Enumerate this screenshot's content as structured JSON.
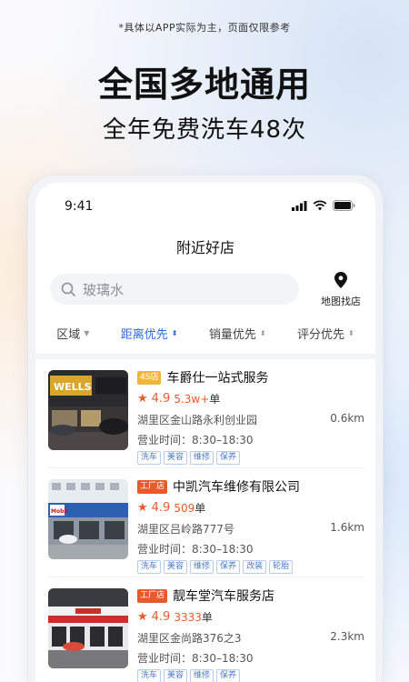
{
  "promo": {
    "disclaimer": "*具体以APP实际为主，页面仅限参考",
    "headline": "全国多地通用",
    "subline": "全年免费洗车48次"
  },
  "status_bar": {
    "time": "9:41",
    "icons": [
      "signal-icon",
      "wifi-icon",
      "battery-icon"
    ]
  },
  "nav": {
    "title": "附近好店"
  },
  "search": {
    "placeholder": "玻璃水",
    "map_label": "地图找店"
  },
  "filters": [
    {
      "label": "区域",
      "active": false
    },
    {
      "label": "距离优先",
      "active": true
    },
    {
      "label": "销量优先",
      "active": false
    },
    {
      "label": "评分优先",
      "active": false
    }
  ],
  "shops": [
    {
      "badge": "4S店",
      "name": "车爵仕一站式服务",
      "rating": "4.9",
      "orders": "5.3w+",
      "orders_suffix": "单",
      "address": "湖里区金山路永利创业园",
      "distance": "0.6km",
      "hours": "营业时间：8:30–18:30",
      "tags": [
        "洗车",
        "美容",
        "维修",
        "保养"
      ]
    },
    {
      "badge": "工厂店",
      "name": "中凯汽车维修有限公司",
      "rating": "4.9",
      "orders": "509",
      "orders_suffix": "单",
      "address": "湖里区吕岭路777号",
      "distance": "1.6km",
      "hours": "营业时间：8:30–18:30",
      "tags": [
        "洗车",
        "美容",
        "维修",
        "保养",
        "改装",
        "轮胎"
      ]
    },
    {
      "badge": "工厂店",
      "name": "靓车堂汽车服务店",
      "rating": "4.9",
      "orders": "3333",
      "orders_suffix": "单",
      "address": "湖里区金尚路376之3",
      "distance": "2.3km",
      "hours": "营业时间：8:30–18:30",
      "tags": [
        "洗车",
        "美容",
        "维修",
        "保养"
      ]
    }
  ],
  "colors": {
    "accent_blue": "#2f6bd8",
    "accent_orange": "#e85a2b",
    "badge_4s": "#f4b63a"
  }
}
